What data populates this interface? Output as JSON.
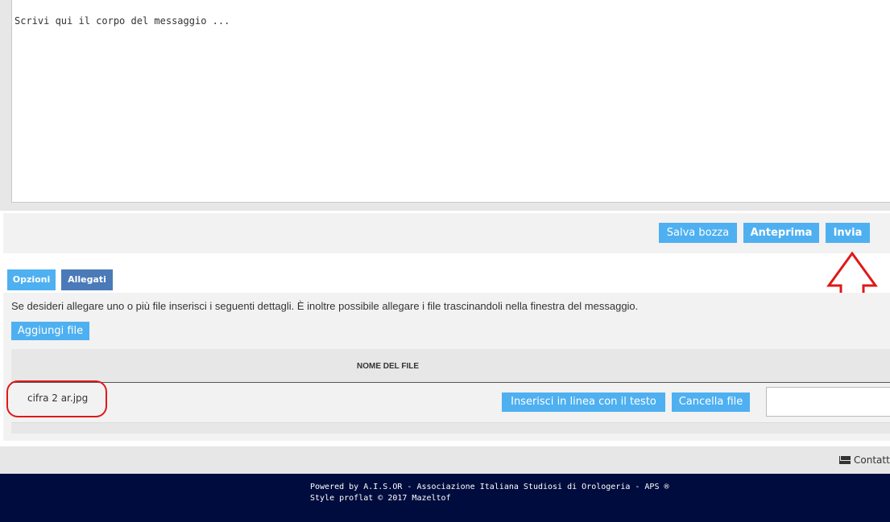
{
  "editor": {
    "placeholder": "Scrivi qui il corpo del messaggio ..."
  },
  "actions": {
    "save_draft": "Salva bozza",
    "preview": "Anteprima",
    "send": "Invia"
  },
  "tabs": [
    {
      "label": "Opzioni",
      "active": false
    },
    {
      "label": "Allegati",
      "active": true
    }
  ],
  "attachments": {
    "description": "Se desideri allegare uno o più file inserisci i seguenti dettagli. È inoltre possibile allegare i file trascinandoli nella finestra del messaggio.",
    "add_file": "Aggiungi file",
    "column_header": "NOME DEL FILE",
    "files": [
      {
        "name": "cifra 2 ar.jpg",
        "insert_inline": "Inserisci in linea con il testo",
        "delete": "Cancella file"
      }
    ]
  },
  "footer": {
    "contact": "Contatta",
    "powered_by": "Powered by A.I.S.OR - Associazione Italiana Studiosi di Orologeria - APS ®",
    "style": "Style proflat © 2017 Mazeltof"
  },
  "colors": {
    "button_blue": "#4eb0f0",
    "tab_active": "#4a7ab8",
    "footer_navy": "#000c3d",
    "annotation_red": "#e01818"
  }
}
